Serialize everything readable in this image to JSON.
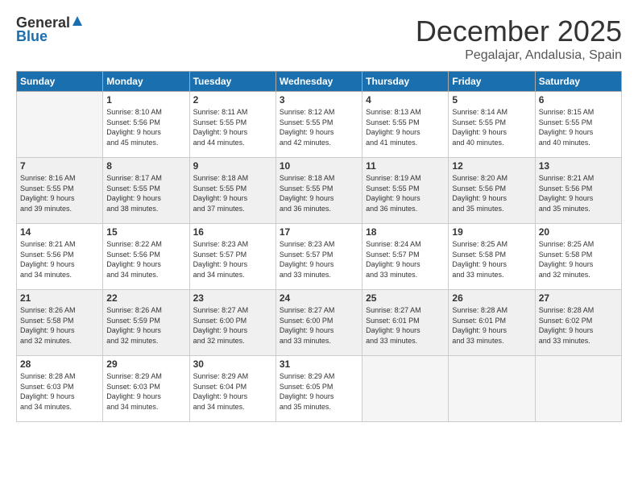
{
  "logo": {
    "general": "General",
    "blue": "Blue"
  },
  "header": {
    "month_year": "December 2025",
    "location": "Pegalajar, Andalusia, Spain"
  },
  "weekdays": [
    "Sunday",
    "Monday",
    "Tuesday",
    "Wednesday",
    "Thursday",
    "Friday",
    "Saturday"
  ],
  "weeks": [
    [
      {
        "day": "",
        "empty": true
      },
      {
        "day": "1",
        "sunrise": "8:10 AM",
        "sunset": "5:56 PM",
        "daylight": "9 hours and 45 minutes."
      },
      {
        "day": "2",
        "sunrise": "8:11 AM",
        "sunset": "5:55 PM",
        "daylight": "9 hours and 44 minutes."
      },
      {
        "day": "3",
        "sunrise": "8:12 AM",
        "sunset": "5:55 PM",
        "daylight": "9 hours and 42 minutes."
      },
      {
        "day": "4",
        "sunrise": "8:13 AM",
        "sunset": "5:55 PM",
        "daylight": "9 hours and 41 minutes."
      },
      {
        "day": "5",
        "sunrise": "8:14 AM",
        "sunset": "5:55 PM",
        "daylight": "9 hours and 40 minutes."
      },
      {
        "day": "6",
        "sunrise": "8:15 AM",
        "sunset": "5:55 PM",
        "daylight": "9 hours and 40 minutes."
      }
    ],
    [
      {
        "day": "7",
        "sunrise": "8:16 AM",
        "sunset": "5:55 PM",
        "daylight": "9 hours and 39 minutes."
      },
      {
        "day": "8",
        "sunrise": "8:17 AM",
        "sunset": "5:55 PM",
        "daylight": "9 hours and 38 minutes."
      },
      {
        "day": "9",
        "sunrise": "8:18 AM",
        "sunset": "5:55 PM",
        "daylight": "9 hours and 37 minutes."
      },
      {
        "day": "10",
        "sunrise": "8:18 AM",
        "sunset": "5:55 PM",
        "daylight": "9 hours and 36 minutes."
      },
      {
        "day": "11",
        "sunrise": "8:19 AM",
        "sunset": "5:55 PM",
        "daylight": "9 hours and 36 minutes."
      },
      {
        "day": "12",
        "sunrise": "8:20 AM",
        "sunset": "5:56 PM",
        "daylight": "9 hours and 35 minutes."
      },
      {
        "day": "13",
        "sunrise": "8:21 AM",
        "sunset": "5:56 PM",
        "daylight": "9 hours and 35 minutes."
      }
    ],
    [
      {
        "day": "14",
        "sunrise": "8:21 AM",
        "sunset": "5:56 PM",
        "daylight": "9 hours and 34 minutes."
      },
      {
        "day": "15",
        "sunrise": "8:22 AM",
        "sunset": "5:56 PM",
        "daylight": "9 hours and 34 minutes."
      },
      {
        "day": "16",
        "sunrise": "8:23 AM",
        "sunset": "5:57 PM",
        "daylight": "9 hours and 34 minutes."
      },
      {
        "day": "17",
        "sunrise": "8:23 AM",
        "sunset": "5:57 PM",
        "daylight": "9 hours and 33 minutes."
      },
      {
        "day": "18",
        "sunrise": "8:24 AM",
        "sunset": "5:57 PM",
        "daylight": "9 hours and 33 minutes."
      },
      {
        "day": "19",
        "sunrise": "8:25 AM",
        "sunset": "5:58 PM",
        "daylight": "9 hours and 33 minutes."
      },
      {
        "day": "20",
        "sunrise": "8:25 AM",
        "sunset": "5:58 PM",
        "daylight": "9 hours and 32 minutes."
      }
    ],
    [
      {
        "day": "21",
        "sunrise": "8:26 AM",
        "sunset": "5:58 PM",
        "daylight": "9 hours and 32 minutes."
      },
      {
        "day": "22",
        "sunrise": "8:26 AM",
        "sunset": "5:59 PM",
        "daylight": "9 hours and 32 minutes."
      },
      {
        "day": "23",
        "sunrise": "8:27 AM",
        "sunset": "6:00 PM",
        "daylight": "9 hours and 32 minutes."
      },
      {
        "day": "24",
        "sunrise": "8:27 AM",
        "sunset": "6:00 PM",
        "daylight": "9 hours and 33 minutes."
      },
      {
        "day": "25",
        "sunrise": "8:27 AM",
        "sunset": "6:01 PM",
        "daylight": "9 hours and 33 minutes."
      },
      {
        "day": "26",
        "sunrise": "8:28 AM",
        "sunset": "6:01 PM",
        "daylight": "9 hours and 33 minutes."
      },
      {
        "day": "27",
        "sunrise": "8:28 AM",
        "sunset": "6:02 PM",
        "daylight": "9 hours and 33 minutes."
      }
    ],
    [
      {
        "day": "28",
        "sunrise": "8:28 AM",
        "sunset": "6:03 PM",
        "daylight": "9 hours and 34 minutes."
      },
      {
        "day": "29",
        "sunrise": "8:29 AM",
        "sunset": "6:03 PM",
        "daylight": "9 hours and 34 minutes."
      },
      {
        "day": "30",
        "sunrise": "8:29 AM",
        "sunset": "6:04 PM",
        "daylight": "9 hours and 34 minutes."
      },
      {
        "day": "31",
        "sunrise": "8:29 AM",
        "sunset": "6:05 PM",
        "daylight": "9 hours and 35 minutes."
      },
      {
        "day": "",
        "empty": true
      },
      {
        "day": "",
        "empty": true
      },
      {
        "day": "",
        "empty": true
      }
    ]
  ]
}
